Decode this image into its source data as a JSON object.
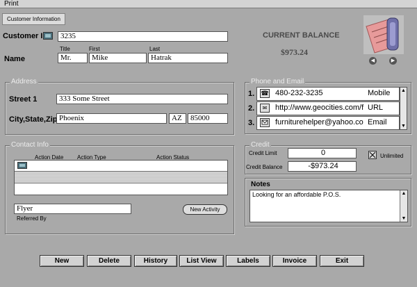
{
  "menu": {
    "print": "Print"
  },
  "tab": {
    "label": "Customer Information"
  },
  "customer": {
    "id_label": "Customer ID",
    "id_value": "3235",
    "name_label": "Name",
    "title_label": "Title",
    "first_label": "First",
    "last_label": "Last",
    "title_value": "Mr.",
    "first_value": "Mike",
    "last_value": "Hatrak"
  },
  "balance": {
    "label": "CURRENT BALANCE",
    "value": "$973.24"
  },
  "address": {
    "legend": "Address",
    "street_label": "Street 1",
    "street_value": "333 Some Street",
    "city_label": "City,State,Zip",
    "city_value": "Phoenix",
    "state_value": "AZ",
    "zip_value": "85000"
  },
  "phone_email": {
    "legend": "Phone and Email",
    "rows": [
      {
        "num": "1.",
        "icon": "phone-icon",
        "value": "480-232-3235",
        "type": "Mobile"
      },
      {
        "num": "2.",
        "icon": "url-icon",
        "value": "http://www.geocities.com/f",
        "type": "URL"
      },
      {
        "num": "3.",
        "icon": "email-icon",
        "value": "furniturehelper@yahoo.co",
        "type": "Email"
      }
    ]
  },
  "contact": {
    "legend": "Contact Info",
    "col_date": "Action Date",
    "col_type": "Action Type",
    "col_status": "Action Status",
    "referred_value": "Flyer",
    "referred_label": "Referred By",
    "new_activity": "New Activity"
  },
  "credit": {
    "legend": "Credit",
    "limit_label": "Credit Limit",
    "limit_value": "0",
    "balance_label": "Credit Balance",
    "balance_value": "-$973.24",
    "unlimited_label": "Unlimited",
    "unlimited_checked": true
  },
  "notes": {
    "label": "Notes",
    "value": "Looking for an affordable P.O.S."
  },
  "buttons": {
    "new": "New",
    "delete": "Delete",
    "history": "History",
    "list_view": "List View",
    "labels": "Labels",
    "invoice": "Invoice",
    "exit": "Exit"
  }
}
